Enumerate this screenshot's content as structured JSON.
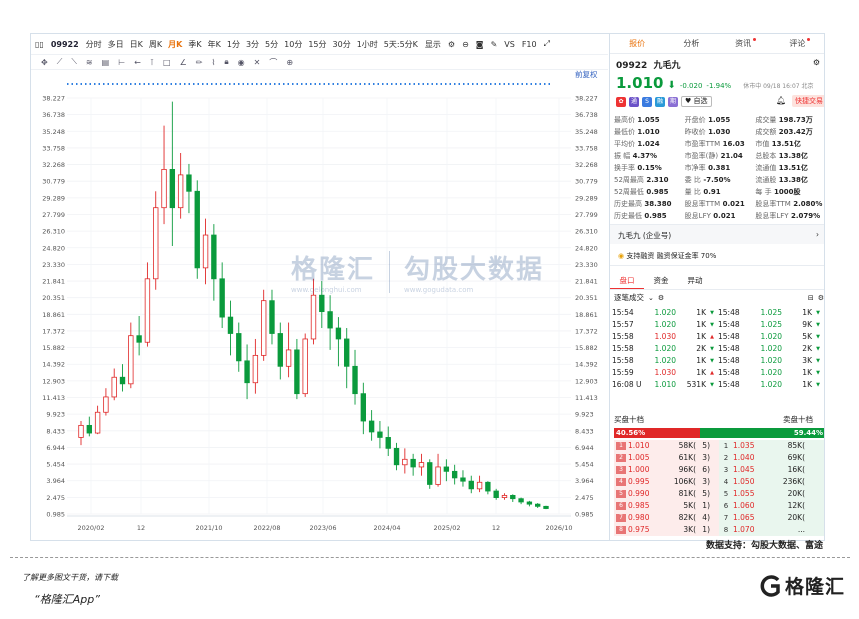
{
  "toolbar": {
    "code": "09922",
    "periods": [
      "分时",
      "多日",
      "日K",
      "周K",
      "月K",
      "季K",
      "年K",
      "1分",
      "3分",
      "5分",
      "10分",
      "15分",
      "30分",
      "1小时",
      "5天:5分K"
    ],
    "active_period": "月K",
    "display": "显示",
    "vs": "VS",
    "f10": "F10"
  },
  "chart": {
    "adjust_label": "前复权",
    "y_ticks": [
      "38.227",
      "36.738",
      "35.248",
      "33.758",
      "32.268",
      "30.779",
      "29.289",
      "27.799",
      "26.310",
      "24.820",
      "23.330",
      "21.841",
      "20.351",
      "18.861",
      "17.372",
      "15.882",
      "14.392",
      "12.903",
      "11.413",
      "9.923",
      "8.433",
      "6.944",
      "5.454",
      "3.964",
      "2.475",
      "0.985"
    ],
    "x_ticks": [
      "2020/02",
      "12",
      "2021/10",
      "2022/08",
      "2023/06",
      "2024/04",
      "2025/02",
      "12",
      "2026/10"
    ],
    "y_min": 0.985,
    "y_max": 38.227,
    "up_color": "#e02828",
    "down_color": "#0a9a3c"
  },
  "chart_data": {
    "type": "candlestick",
    "candles": [
      [
        7.5,
        8.6,
        6.8,
        9.0
      ],
      [
        8.6,
        7.9,
        7.6,
        9.4
      ],
      [
        7.9,
        9.8,
        7.8,
        10.4
      ],
      [
        9.8,
        11.2,
        9.5,
        12.0
      ],
      [
        11.2,
        13.0,
        10.9,
        13.8
      ],
      [
        13.0,
        12.4,
        11.7,
        14.2
      ],
      [
        12.4,
        16.8,
        12.0,
        18.0
      ],
      [
        16.8,
        16.2,
        15.0,
        18.6
      ],
      [
        16.2,
        22.0,
        15.8,
        23.5
      ],
      [
        22.0,
        28.5,
        21.0,
        30.0
      ],
      [
        28.5,
        32.0,
        27.0,
        36.0
      ],
      [
        32.0,
        28.5,
        25.0,
        38.2
      ],
      [
        28.5,
        31.5,
        27.5,
        33.5
      ],
      [
        31.5,
        30.0,
        28.0,
        32.5
      ],
      [
        30.0,
        23.0,
        22.0,
        31.0
      ],
      [
        23.0,
        26.0,
        21.5,
        27.5
      ],
      [
        26.0,
        22.0,
        20.0,
        27.0
      ],
      [
        22.0,
        18.5,
        17.5,
        23.5
      ],
      [
        18.5,
        17.0,
        15.0,
        20.0
      ],
      [
        17.0,
        14.5,
        13.5,
        18.0
      ],
      [
        14.5,
        12.5,
        11.0,
        16.0
      ],
      [
        12.5,
        15.0,
        11.5,
        16.5
      ],
      [
        15.0,
        20.0,
        14.5,
        21.0
      ],
      [
        20.0,
        17.0,
        16.0,
        21.0
      ],
      [
        17.0,
        14.0,
        12.8,
        18.0
      ],
      [
        14.0,
        15.5,
        13.0,
        18.0
      ],
      [
        15.5,
        11.5,
        11.0,
        16.5
      ],
      [
        11.5,
        16.5,
        11.2,
        17.0
      ],
      [
        16.5,
        20.5,
        16.0,
        22.0
      ],
      [
        20.5,
        19.0,
        17.5,
        21.8
      ],
      [
        19.0,
        17.5,
        15.5,
        20.5
      ],
      [
        17.5,
        16.5,
        14.0,
        18.5
      ],
      [
        16.5,
        14.0,
        12.0,
        17.5
      ],
      [
        14.0,
        11.5,
        10.5,
        15.5
      ],
      [
        11.5,
        9.0,
        7.8,
        12.5
      ],
      [
        9.0,
        8.0,
        7.2,
        10.0
      ],
      [
        8.0,
        7.5,
        6.5,
        9.0
      ],
      [
        7.5,
        6.5,
        5.8,
        8.5
      ],
      [
        6.5,
        5.0,
        4.5,
        7.0
      ],
      [
        5.0,
        5.5,
        4.2,
        6.5
      ],
      [
        5.5,
        4.8,
        4.0,
        6.0
      ],
      [
        4.8,
        5.2,
        4.0,
        6.0
      ],
      [
        5.2,
        3.2,
        2.8,
        5.5
      ],
      [
        3.2,
        4.8,
        3.0,
        6.0
      ],
      [
        4.8,
        4.4,
        3.5,
        5.5
      ],
      [
        4.4,
        3.8,
        3.2,
        5.0
      ],
      [
        3.8,
        3.5,
        3.0,
        4.5
      ],
      [
        3.5,
        2.8,
        2.4,
        4.0
      ],
      [
        2.8,
        3.4,
        2.5,
        4.0
      ],
      [
        3.4,
        2.6,
        2.3,
        3.5
      ],
      [
        2.6,
        2.0,
        1.8,
        2.8
      ],
      [
        2.0,
        2.2,
        1.8,
        2.4
      ],
      [
        2.2,
        1.9,
        1.6,
        2.3
      ],
      [
        1.9,
        1.6,
        1.4,
        2.0
      ],
      [
        1.6,
        1.4,
        1.2,
        1.7
      ],
      [
        1.4,
        1.2,
        1.05,
        1.5
      ],
      [
        1.2,
        1.0,
        0.95,
        1.25
      ]
    ]
  },
  "panel": {
    "tabs": [
      "报价",
      "分析",
      "资讯",
      "评论"
    ],
    "code": "09922",
    "name": "九毛九",
    "price": "1.010",
    "arrow": "⬇",
    "change": "-0.020",
    "change_pct": "-1.94%",
    "status": "休市中 09/18 16:07 北京",
    "fav": "自选",
    "quick_trade": "快捷交易"
  },
  "stats": [
    [
      "最高价",
      "1.055",
      "开盘价",
      "1.055",
      "成交量",
      "198.73万"
    ],
    [
      "最低价",
      "1.010",
      "昨收价",
      "1.030",
      "成交额",
      "203.42万"
    ],
    [
      "平均价",
      "1.024",
      "市盈率TTM",
      "16.03",
      "市值",
      "13.51亿"
    ],
    [
      "振 幅",
      "4.37%",
      "市盈率(静)",
      "21.04",
      "总股本",
      "13.38亿"
    ],
    [
      "换手率",
      "0.15%",
      "市净率",
      "0.381",
      "流通值",
      "13.51亿"
    ],
    [
      "52周最高",
      "2.310",
      "委 比",
      "-7.50%",
      "流通股",
      "13.38亿"
    ],
    [
      "52周最低",
      "0.985",
      "量 比",
      "0.91",
      "每 手",
      "1000股"
    ],
    [
      "历史最高",
      "38.380",
      "股息率TTM",
      "0.021",
      "股息率TTM",
      "2.080%"
    ],
    [
      "历史最低",
      "0.985",
      "股息LFY",
      "0.021",
      "股息率LFY",
      "2.079%"
    ]
  ],
  "cards": {
    "company": "九毛九 (企业号)",
    "margin": "支持融资 融资保证金率 70%"
  },
  "subtabs": [
    "盘口",
    "资金",
    "异动"
  ],
  "ticks": {
    "title": "逐笔成交",
    "left": [
      [
        "15:54",
        "1.020",
        "1K",
        "d"
      ],
      [
        "15:57",
        "1.020",
        "1K",
        "d"
      ],
      [
        "15:58",
        "1.030",
        "1K",
        "u"
      ],
      [
        "15:58",
        "1.020",
        "2K",
        "d"
      ],
      [
        "15:58",
        "1.020",
        "1K",
        "d"
      ],
      [
        "15:59",
        "1.030",
        "1K",
        "u"
      ],
      [
        "16:08 U",
        "1.010",
        "531K",
        "d"
      ]
    ],
    "right": [
      [
        "15:48",
        "1.025",
        "1K",
        "d"
      ],
      [
        "15:48",
        "1.025",
        "9K",
        "d"
      ],
      [
        "15:48",
        "1.020",
        "5K",
        "d"
      ],
      [
        "15:48",
        "1.020",
        "2K",
        "d"
      ],
      [
        "15:48",
        "1.020",
        "3K",
        "d"
      ],
      [
        "15:48",
        "1.020",
        "1K",
        "d"
      ],
      [
        "15:48",
        "1.020",
        "1K",
        "d"
      ]
    ]
  },
  "orderbook": {
    "buy_title": "买盘十档",
    "sell_title": "卖盘十档",
    "buy_pct": "40.56%",
    "sell_pct": "59.44%",
    "buy_ratio": 40.56,
    "rows": [
      [
        "1",
        "1.010",
        "58K(",
        "5)",
        "1",
        "1.035",
        "85K("
      ],
      [
        "2",
        "1.005",
        "61K(",
        "3)",
        "2",
        "1.040",
        "69K("
      ],
      [
        "3",
        "1.000",
        "96K(",
        "6)",
        "3",
        "1.045",
        "16K("
      ],
      [
        "4",
        "0.995",
        "106K(",
        "3)",
        "4",
        "1.050",
        "236K("
      ],
      [
        "5",
        "0.990",
        "81K(",
        "5)",
        "5",
        "1.055",
        "20K("
      ],
      [
        "6",
        "0.985",
        "5K(",
        "1)",
        "6",
        "1.060",
        "12K("
      ],
      [
        "7",
        "0.980",
        "82K(",
        "4)",
        "7",
        "1.065",
        "20K("
      ],
      [
        "8",
        "0.975",
        "3K(",
        "1)",
        "8",
        "1.070",
        "..."
      ]
    ]
  },
  "footer": {
    "source": "数据支持：勾股大数据、富途",
    "promo_line1": "了解更多图文干货，请下载",
    "promo_line2": "“格隆汇App”",
    "brand": "格隆汇"
  },
  "watermark": {
    "brand": "格隆汇",
    "brand_url": "www.gelonghui.com",
    "data": "勾股大数据",
    "data_url": "www.gogudata.com"
  }
}
